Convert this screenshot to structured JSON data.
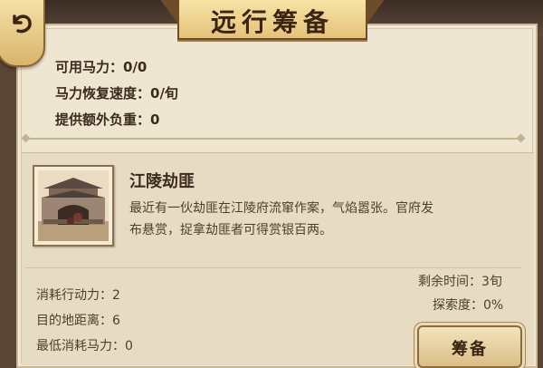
{
  "header": {
    "title": "远行筹备"
  },
  "stats": {
    "horsepower": "可用马力：0/0",
    "recovery": "马力恢复速度：0/旬",
    "load": "提供额外负重：0"
  },
  "mission": {
    "title": "江陵劫匪",
    "description_line1": "最近有一伙劫匪在江陵府流窜作案，气焰嚣张。官府发",
    "description_line2": "布悬赏，捉拿劫匪者可得赏银百两。",
    "cost_action": "消耗行动力：2",
    "distance": "目的地距离：6",
    "min_horsepower": "最低消耗马力：0",
    "time_left": "剩余时间：3旬",
    "exploration": "探索度：0%",
    "prepare_label": "筹备"
  },
  "icons": {
    "back": "back-arrow-icon"
  }
}
